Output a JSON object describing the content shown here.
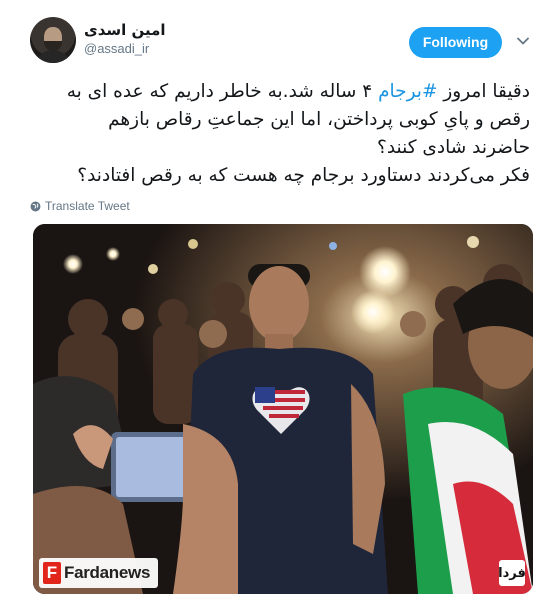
{
  "user": {
    "display_name": "امین اسدی",
    "handle": "@assadi_ir"
  },
  "follow_button": {
    "label": "Following"
  },
  "tweet": {
    "line1_prefix": "دقیقا امروز ",
    "hashtag": "#برجام",
    "line1_suffix": " ۴ ساله شد.به خاطر داریم که عده ای به",
    "line2": "رقص و پایِ کوبی پرداختن، اما این جماعتِ رقاص بازهم",
    "line3": "حاضرند شادی کنند؟",
    "line4": "فکر می‌کردند دستاورد برجام چه هست که به رقص افتادند؟"
  },
  "translate": {
    "label": "Translate Tweet"
  },
  "media": {
    "watermark_text": "Fardanews",
    "watermark_initial": "F",
    "corner_logo_text": "فردا"
  },
  "colors": {
    "accent": "#1da1f2",
    "hashtag": "#1b95e0",
    "secondary_text": "#657786"
  },
  "icons": {
    "avatar": "profile-avatar",
    "chevron": "chevron-down-icon",
    "globe": "globe-icon"
  }
}
